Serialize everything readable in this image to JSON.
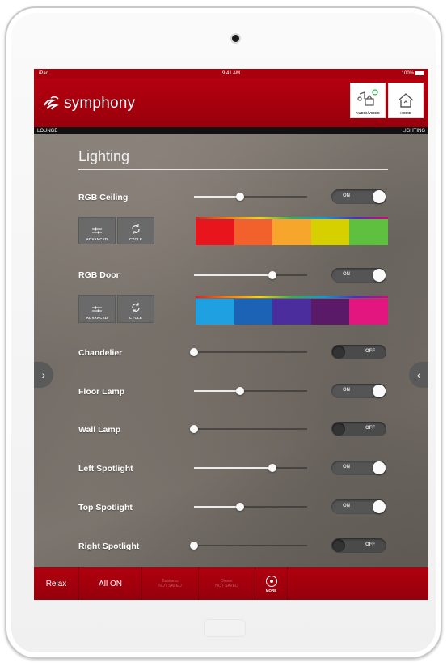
{
  "status_bar": {
    "carrier": "iPad",
    "time": "9:41 AM",
    "battery": "100%"
  },
  "header": {
    "brand": "symphony",
    "audio_video_label": "AUDIO/VIDEO",
    "home_label": "HOME"
  },
  "room_bar": {
    "room": "LOUNGE",
    "section": "LIGHTING"
  },
  "page_title": "Lighting",
  "controls": [
    {
      "label": "RGB Ceiling",
      "level": 0.41,
      "state": "ON"
    },
    {
      "label": "RGB Door",
      "level": 0.69,
      "state": "ON"
    },
    {
      "label": "Chandelier",
      "level": 0.0,
      "state": "OFF"
    },
    {
      "label": "Floor Lamp",
      "level": 0.41,
      "state": "ON"
    },
    {
      "label": "Wall Lamp",
      "level": 0.0,
      "state": "OFF"
    },
    {
      "label": "Left Spotlight",
      "level": 0.69,
      "state": "ON"
    },
    {
      "label": "Top Spotlight",
      "level": 0.41,
      "state": "ON"
    },
    {
      "label": "Right Spotlight",
      "level": 0.0,
      "state": "OFF"
    }
  ],
  "mini_buttons": {
    "advanced": "ADVANCED",
    "cycle": "CYCLE"
  },
  "ceiling_swatches": [
    "#e8151d",
    "#f2612b",
    "#f6a72b",
    "#d6d000",
    "#5fbf3f"
  ],
  "door_swatches": [
    "#1fa0e0",
    "#1c63b6",
    "#4b2d9e",
    "#5a1a68",
    "#e3167f"
  ],
  "scenes": {
    "relax": "Relax",
    "all_on": "All ON",
    "business_line1": "Business",
    "business_line2": "NOT SAVED",
    "dinner_line1": "Dinner",
    "dinner_line2": "NOT SAVED",
    "more": "MORE"
  },
  "colors": {
    "brand_red": "#b5000f",
    "accent_green": "#2db34a"
  }
}
